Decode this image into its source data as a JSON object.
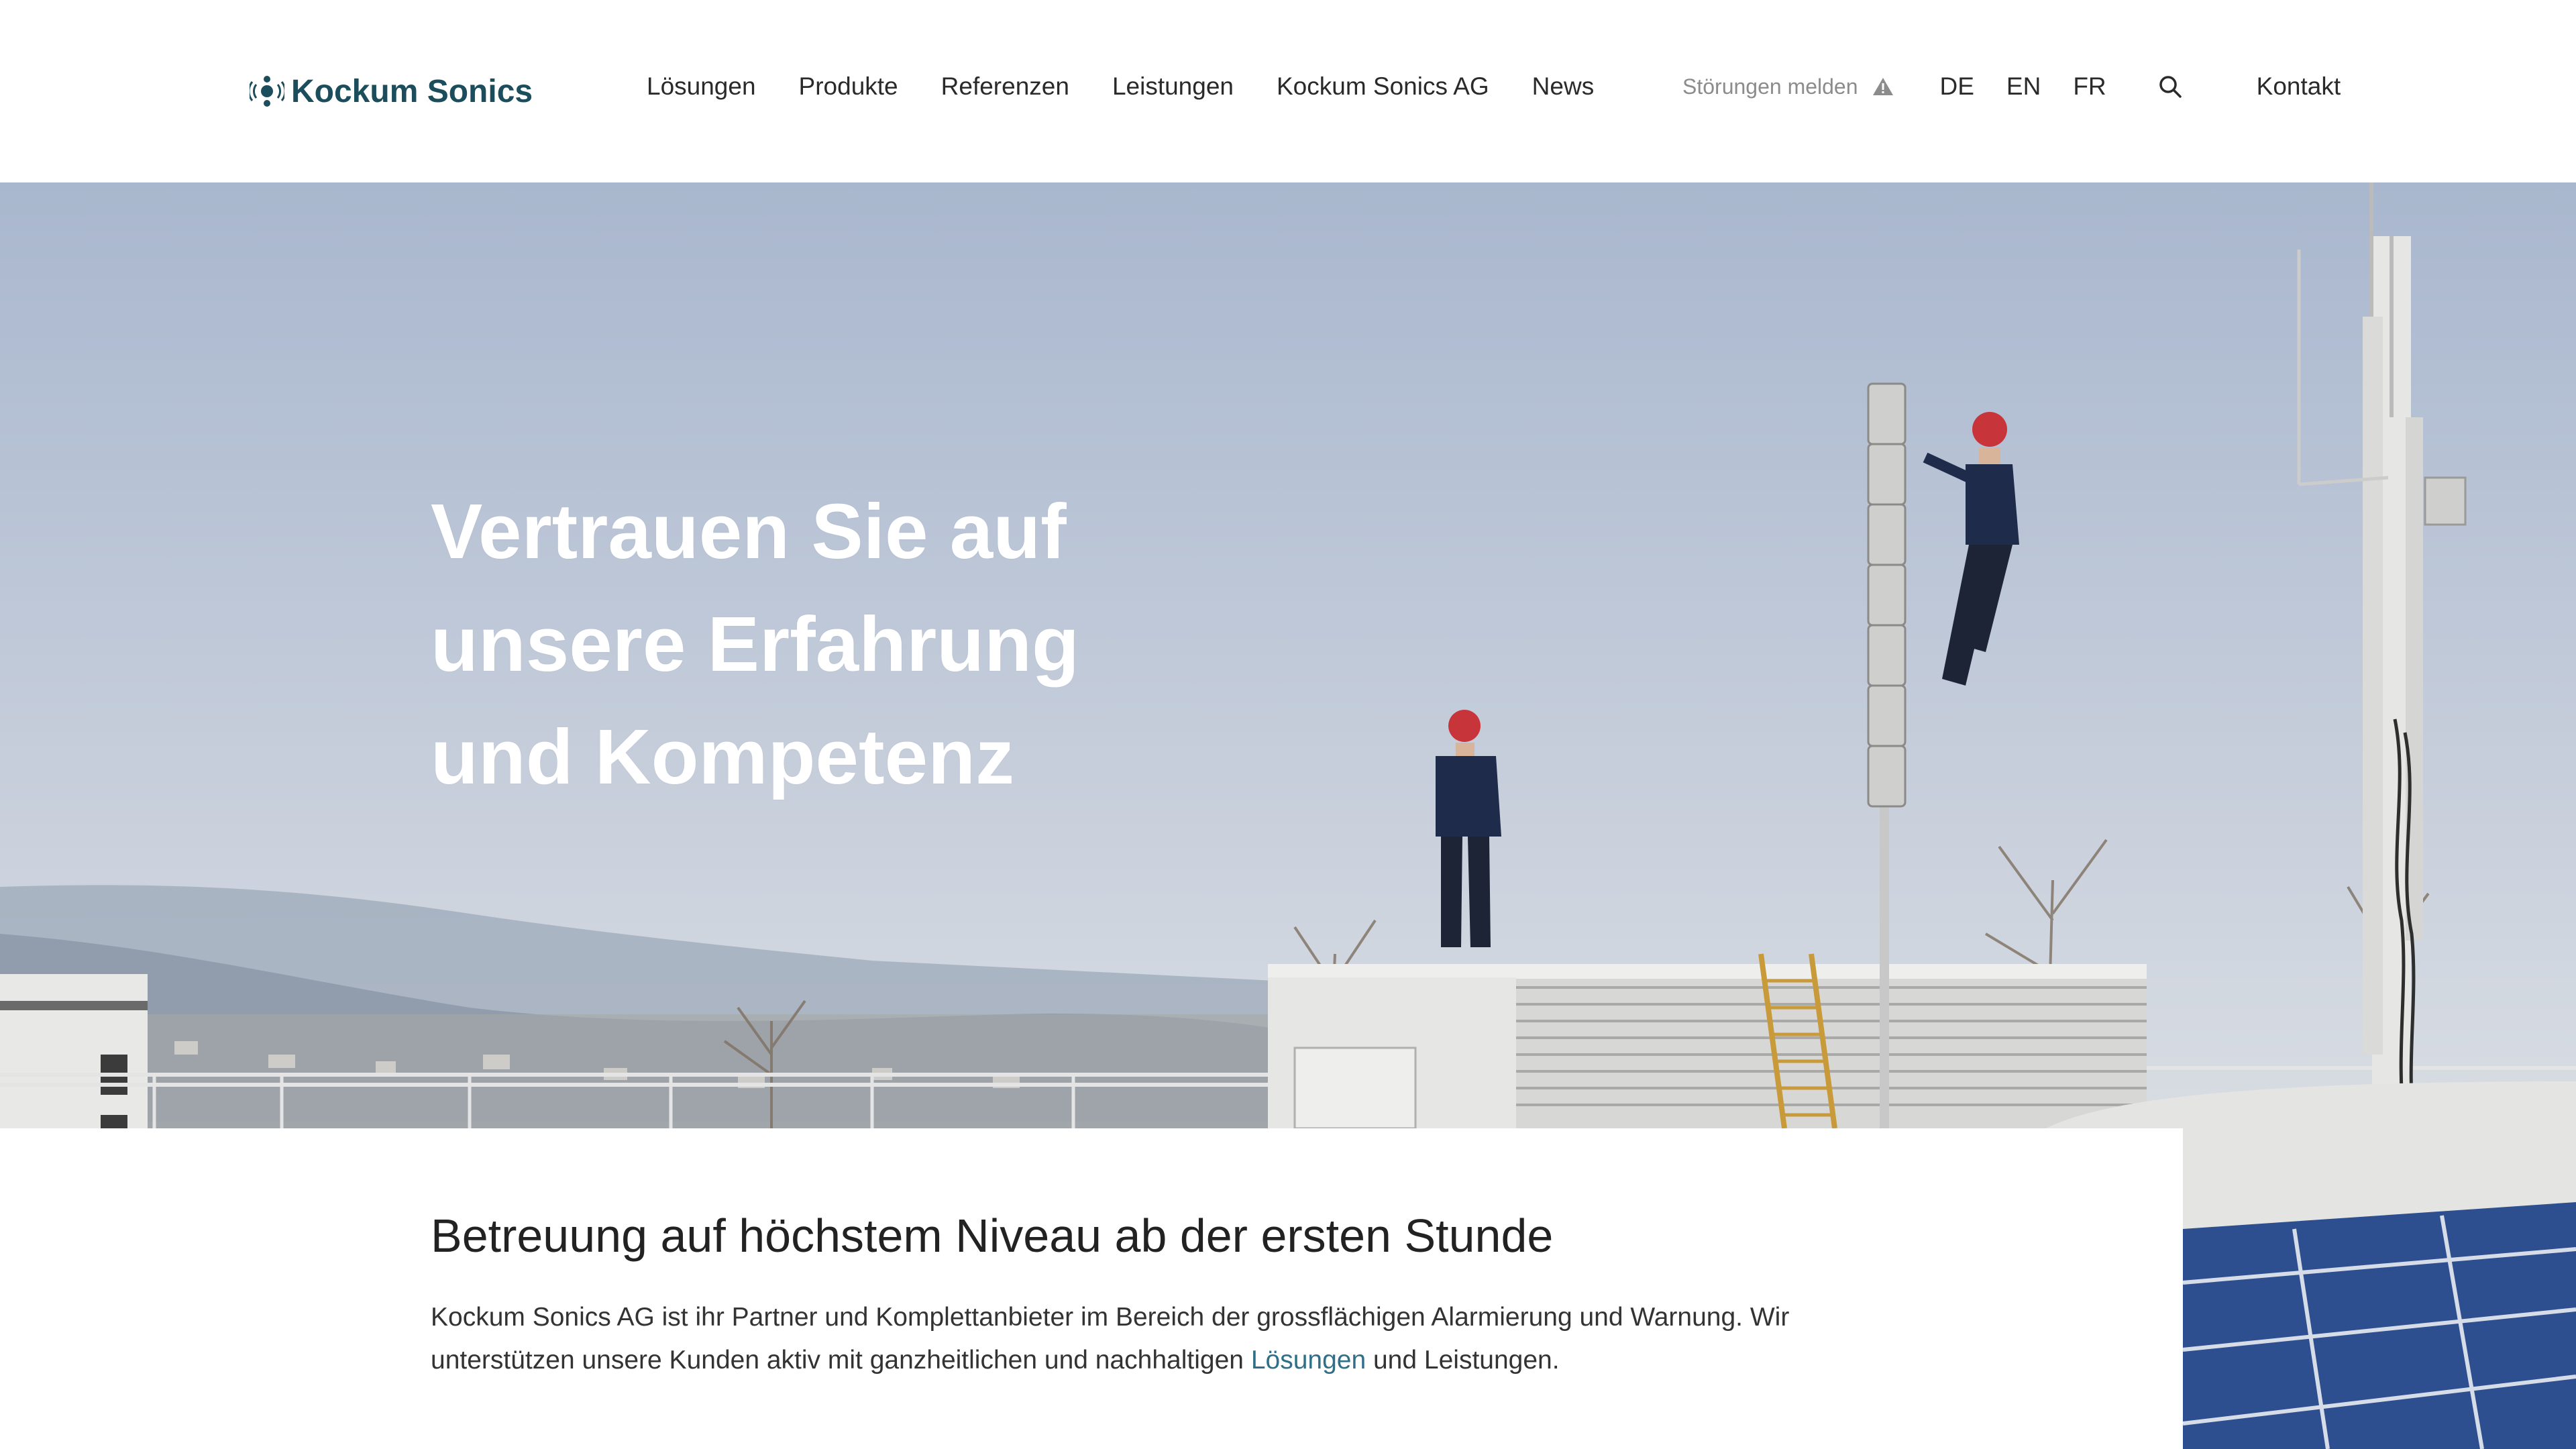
{
  "brand": {
    "name": "Kockum Sonics",
    "color": "#1c4d5c"
  },
  "nav": {
    "items": [
      "Lösungen",
      "Produkte",
      "Referenzen",
      "Leistungen",
      "Kockum Sonics AG",
      "News"
    ]
  },
  "meta": {
    "report_label": "Störungen melden",
    "report_icon": "warning-icon",
    "languages": [
      "DE",
      "EN",
      "FR"
    ],
    "search_icon": "search-icon",
    "contact_label": "Kontakt"
  },
  "hero": {
    "title_lines": [
      "Vertrauen Sie auf",
      "unsere Erfahrung",
      "und Kompetenz"
    ]
  },
  "content": {
    "heading": "Betreuung auf höchstem Niveau ab der ersten Stunde",
    "text_before_link": "Kockum Sonics AG ist ihr Partner und Komplettanbieter im Bereich der grossflächigen Alarmierung und Warnung. Wir unterstützen unsere Kunden aktiv mit ganzheitlichen und nachhaltigen ",
    "link_text": "Lösungen",
    "text_after_link": " und Leistungen.",
    "link_color": "#2f6f8a"
  }
}
